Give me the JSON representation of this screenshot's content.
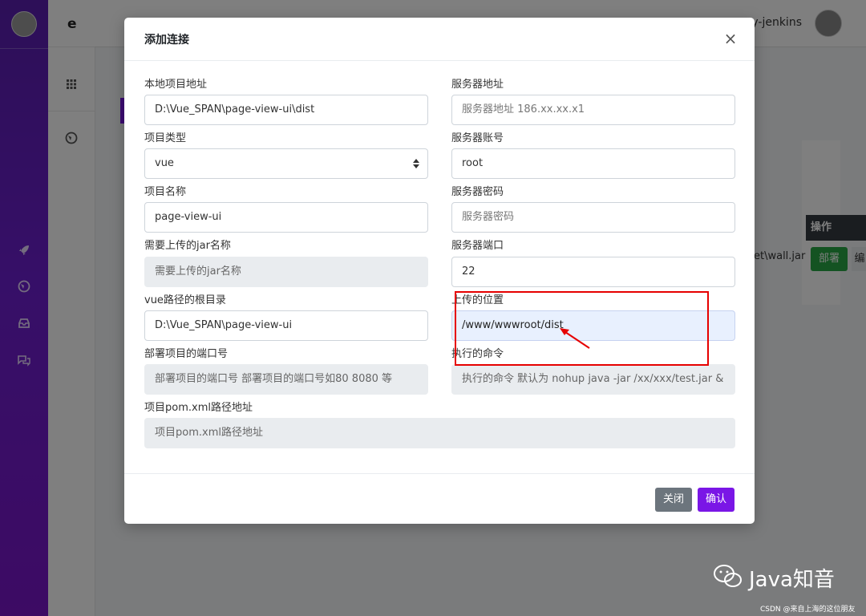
{
  "app": {
    "top_letter": "e",
    "username": "sy-jenkins",
    "table_header_action": "操作",
    "row_file": "et\\wall.jar",
    "deploy_button": "部署",
    "edit_button": "编"
  },
  "modal": {
    "title": "添加连接",
    "close_glyph": "×",
    "fields": {
      "local_path": {
        "label": "本地项目地址",
        "value": "D:\\Vue_SPAN\\page-view-ui\\dist"
      },
      "server_addr": {
        "label": "服务器地址",
        "placeholder": "服务器地址 186.xx.xx.x1"
      },
      "project_type": {
        "label": "项目类型",
        "selected": "vue"
      },
      "server_account": {
        "label": "服务器账号",
        "value": "root"
      },
      "project_name": {
        "label": "项目名称",
        "value": "page-view-ui"
      },
      "server_password": {
        "label": "服务器密码",
        "placeholder": "服务器密码"
      },
      "jar_name": {
        "label": "需要上传的jar名称",
        "placeholder": "需要上传的jar名称"
      },
      "server_port": {
        "label": "服务器端口",
        "value": "22"
      },
      "vue_root": {
        "label": "vue路径的根目录",
        "value": "D:\\Vue_SPAN\\page-view-ui"
      },
      "upload_path": {
        "label": "上传的位置",
        "value": "/www/wwwroot/dist"
      },
      "deploy_port": {
        "label": "部署项目的端口号",
        "placeholder": "部署项目的端口号 部署项目的端口号如80 8080 等"
      },
      "exec_command": {
        "label": "执行的命令",
        "placeholder": "执行的命令 默认为 nohup java -jar /xx/xxx/test.jar &"
      },
      "pom_path": {
        "label": "项目pom.xml路径地址",
        "placeholder": "项目pom.xml路径地址"
      }
    },
    "buttons": {
      "close": "关闭",
      "confirm": "确认"
    }
  },
  "watermark": {
    "brand": "Java知音",
    "credit": "CSDN @来自上海的这位朋友"
  },
  "colors": {
    "accent": "#7a16e6",
    "annotation": "#e60000",
    "success": "#28a745",
    "secondary": "#6c757d"
  }
}
